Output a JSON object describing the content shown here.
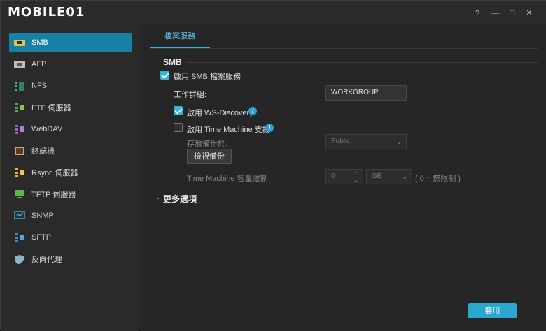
{
  "app": {
    "logo_text": "MOBILE01"
  },
  "window_controls": {
    "help": "?",
    "minimize": "—",
    "maximize": "□",
    "close": "✕"
  },
  "sidebar": {
    "items": [
      {
        "label": "SMB",
        "icon": "smb-icon"
      },
      {
        "label": "AFP",
        "icon": "afp-icon"
      },
      {
        "label": "NFS",
        "icon": "nfs-icon"
      },
      {
        "label": "FTP 伺服器",
        "icon": "ftp-icon"
      },
      {
        "label": "WebDAV",
        "icon": "webdav-icon"
      },
      {
        "label": "終端機",
        "icon": "terminal-icon"
      },
      {
        "label": "Rsync 伺服器",
        "icon": "rsync-icon"
      },
      {
        "label": "TFTP 伺服器",
        "icon": "tftp-icon"
      },
      {
        "label": "SNMP",
        "icon": "snmp-icon"
      },
      {
        "label": "SFTP",
        "icon": "sftp-icon"
      },
      {
        "label": "反向代理",
        "icon": "reverse-proxy-icon"
      }
    ]
  },
  "main": {
    "tab_label": "檔案服務",
    "section_title": "SMB",
    "enable_smb_label": "啟用 SMB 檔案服務",
    "workgroup_label": "工作群組:",
    "workgroup_value": "WORKGROUP",
    "ws_discovery_label": "啟用 WS-Discovery",
    "time_machine_label": "啟用 Time Machine 支援",
    "store_backup_label": "存放備份於:",
    "store_backup_value": "Public",
    "view_backup_button": "檢視備份",
    "tm_limit_label": "Time Machine 容量限制:",
    "tm_limit_value": "0",
    "tm_limit_unit": "GB",
    "tm_limit_hint": "( 0 = 無限制 )",
    "more_options": "更多選項",
    "apply_button": "套用"
  }
}
